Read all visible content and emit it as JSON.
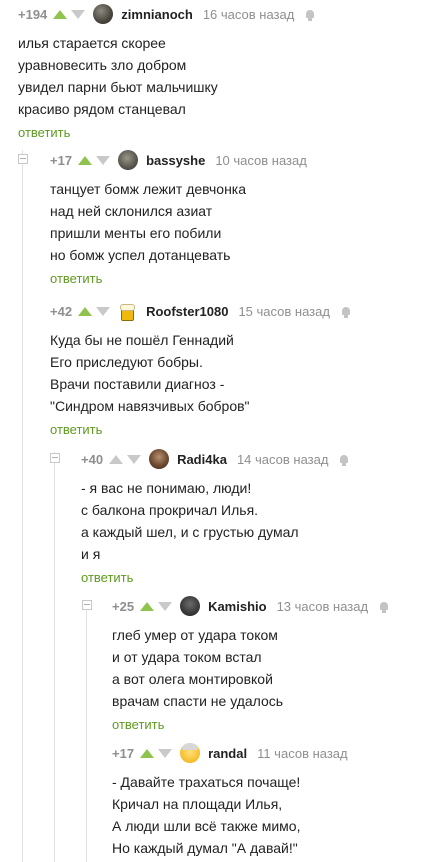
{
  "reply_label": "ответить",
  "colors": {
    "accent_green": "#8fc34d",
    "reply_green": "#5e9a1e",
    "meta_gray": "#8f8f8f"
  },
  "comments": [
    {
      "rating": "+194",
      "username": "zimnianoch",
      "time": "16 часов назад",
      "avatar": "user-avatar",
      "lines": [
        "илья старается скорее",
        "уравновесить зло добром",
        "увидел парни бьют мальчишку",
        "красиво рядом станцевал"
      ]
    },
    {
      "rating": "+17",
      "username": "bassyshe",
      "time": "10 часов назад",
      "avatar": "user-avatar",
      "lines": [
        "танцует бомж лежит девчонка",
        "над ней склонился азиат",
        "пришли менты его побили",
        "но бомж успел дотанцевать"
      ]
    },
    {
      "rating": "+42",
      "username": "Roofster1080",
      "time": "15 часов назад",
      "avatar": "beer-mug-avatar",
      "lines": [
        "Куда бы не пошёл Геннадий",
        "Его приследуют бобры.",
        "Врачи поставили диагноз -",
        "\"Синдром навязчивых бобров\""
      ]
    },
    {
      "rating": "+40",
      "username": "Radi4ka",
      "time": "14 часов назад",
      "avatar": "user-avatar",
      "lines": [
        "- я вас не понимаю, люди!",
        "с балкона прокричал Илья.",
        "а каждый шел, и с грустью думал",
        "и я"
      ]
    },
    {
      "rating": "+25",
      "username": "Kamishio",
      "time": "13 часов назад",
      "avatar": "user-avatar",
      "lines": [
        "глеб умер от удара током",
        "и от удара током встал",
        "а вот олега монтировкой",
        "врачам спасти не удалось"
      ]
    },
    {
      "rating": "+17",
      "username": "randal",
      "time": "11 часов назад",
      "avatar": "emoji-avatar",
      "lines": [
        "- Давайте трахаться почаще!",
        "Кричал на площади Илья,",
        "А люди шли всё также мимо,",
        "Но каждый думал \"А давай!\""
      ]
    }
  ]
}
